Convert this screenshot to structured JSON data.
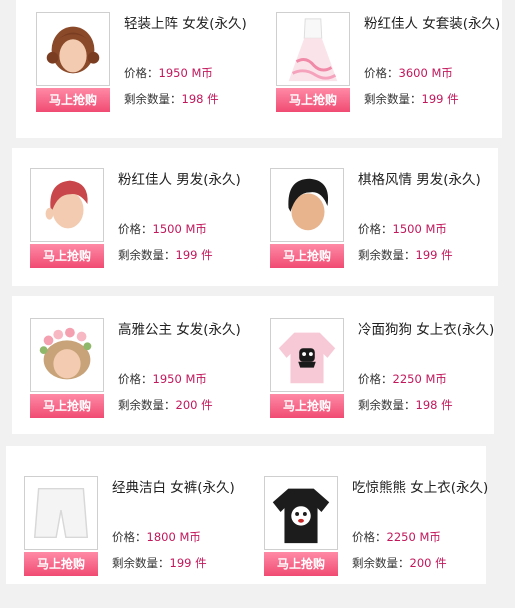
{
  "buy_label": "马上抢购",
  "price_prefix": "价格：",
  "stock_prefix": "剩余数量：",
  "price_unit": "M币",
  "stock_unit": "件",
  "items": [
    {
      "name": "轻装上阵 女发(永久)",
      "price": "1950",
      "stock": "198",
      "icon": "brown-braided-hair-icon"
    },
    {
      "name": "粉红佳人 女套装(永久)",
      "price": "3600",
      "stock": "199",
      "icon": "pink-dress-icon"
    },
    {
      "name": "粉红佳人 男发(永久)",
      "price": "1500",
      "stock": "199",
      "icon": "red-male-hair-icon"
    },
    {
      "name": "棋格风情 男发(永久)",
      "price": "1500",
      "stock": "199",
      "icon": "black-male-hair-icon"
    },
    {
      "name": "高雅公主 女发(永久)",
      "price": "1950",
      "stock": "200",
      "icon": "flower-crown-hair-icon"
    },
    {
      "name": "冷面狗狗 女上衣(永久)",
      "price": "2250",
      "stock": "198",
      "icon": "pink-dog-sweater-icon"
    },
    {
      "name": "经典洁白 女裤(永久)",
      "price": "1800",
      "stock": "199",
      "icon": "white-shorts-icon"
    },
    {
      "name": "吃惊熊熊 女上衣(永久)",
      "price": "2250",
      "stock": "200",
      "icon": "black-bear-tshirt-icon"
    }
  ]
}
